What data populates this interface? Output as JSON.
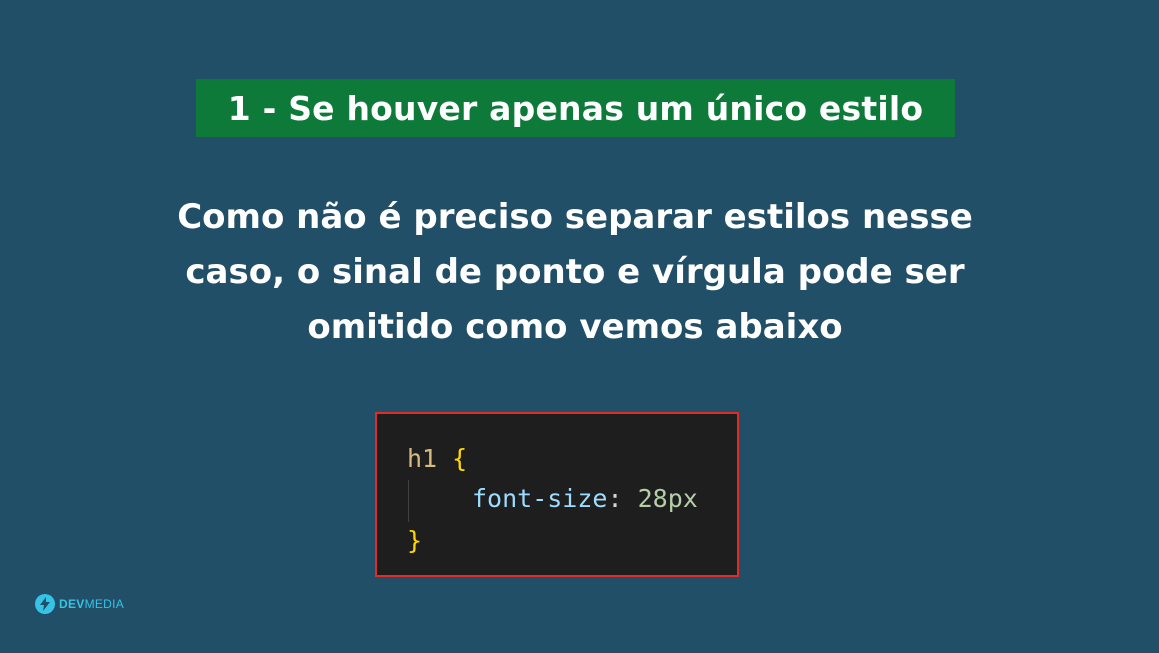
{
  "slide": {
    "title": "1 - Se houver apenas um único estilo",
    "body_lines": [
      "Como não é preciso separar estilos nesse",
      "caso, o sinal de ponto e vírgula pode ser",
      "omitido como vemos abaixo"
    ]
  },
  "code": {
    "selector": "h1",
    "open_brace": "{",
    "property": "font-size",
    "colon": ":",
    "value": "28px",
    "close_brace": "}"
  },
  "logo": {
    "icon": "lightning-bolt-icon",
    "text_dev": "DEV",
    "text_media": "MEDIA"
  },
  "colors": {
    "background": "#224f68",
    "title_bg": "#0d7a3a",
    "code_border": "#e02b2b",
    "code_bg": "#1e1e1e",
    "logo": "#35c4e6"
  }
}
